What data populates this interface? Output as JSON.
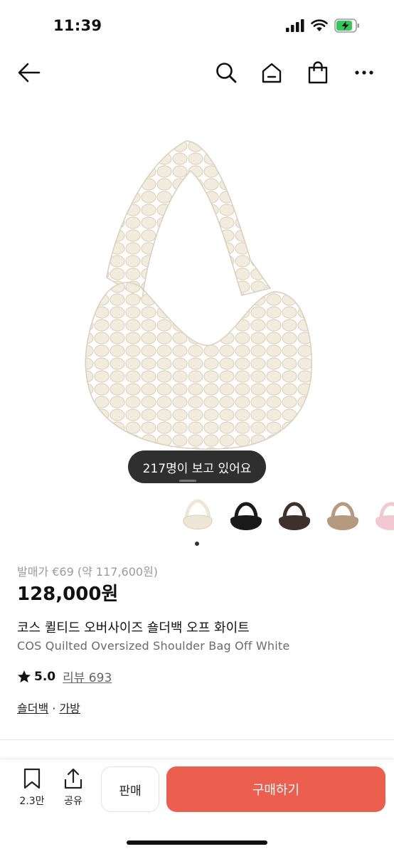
{
  "status_bar": {
    "time": "11:39",
    "icons": [
      "signal-icon",
      "wifi-icon",
      "battery-charging-icon"
    ],
    "battery_color": "#34c759"
  },
  "nav": {
    "icons": [
      "back-arrow-icon",
      "search-icon",
      "home-icon",
      "shopping-bag-icon",
      "more-icon"
    ]
  },
  "product": {
    "viewers_text": "217명이 보고 있어요",
    "thumbnails": [
      {
        "name": "off-white",
        "color": "#eee7d8"
      },
      {
        "name": "black",
        "color": "#1a1a1a"
      },
      {
        "name": "brown",
        "color": "#3e302a"
      },
      {
        "name": "taupe",
        "color": "#b69a80"
      },
      {
        "name": "pink",
        "color": "#f2c9d3"
      }
    ],
    "retail_price": "발매가 €69 (약 117,600원)",
    "price": "128,000원",
    "title_ko": "코스 퀼티드 오버사이즈 숄더백 오프 화이트",
    "title_en": "COS Quilted Oversized Shoulder Bag Off White",
    "rating": "5.0",
    "review_label": "리뷰 693",
    "categories": [
      "숄더백",
      "가방"
    ],
    "category_separator": "·"
  },
  "bottom_bar": {
    "bookmark_count": "2.3만",
    "share_label": "공유",
    "sell_label": "판매",
    "buy_label": "구매하기",
    "buy_color": "#ec5f4e"
  }
}
